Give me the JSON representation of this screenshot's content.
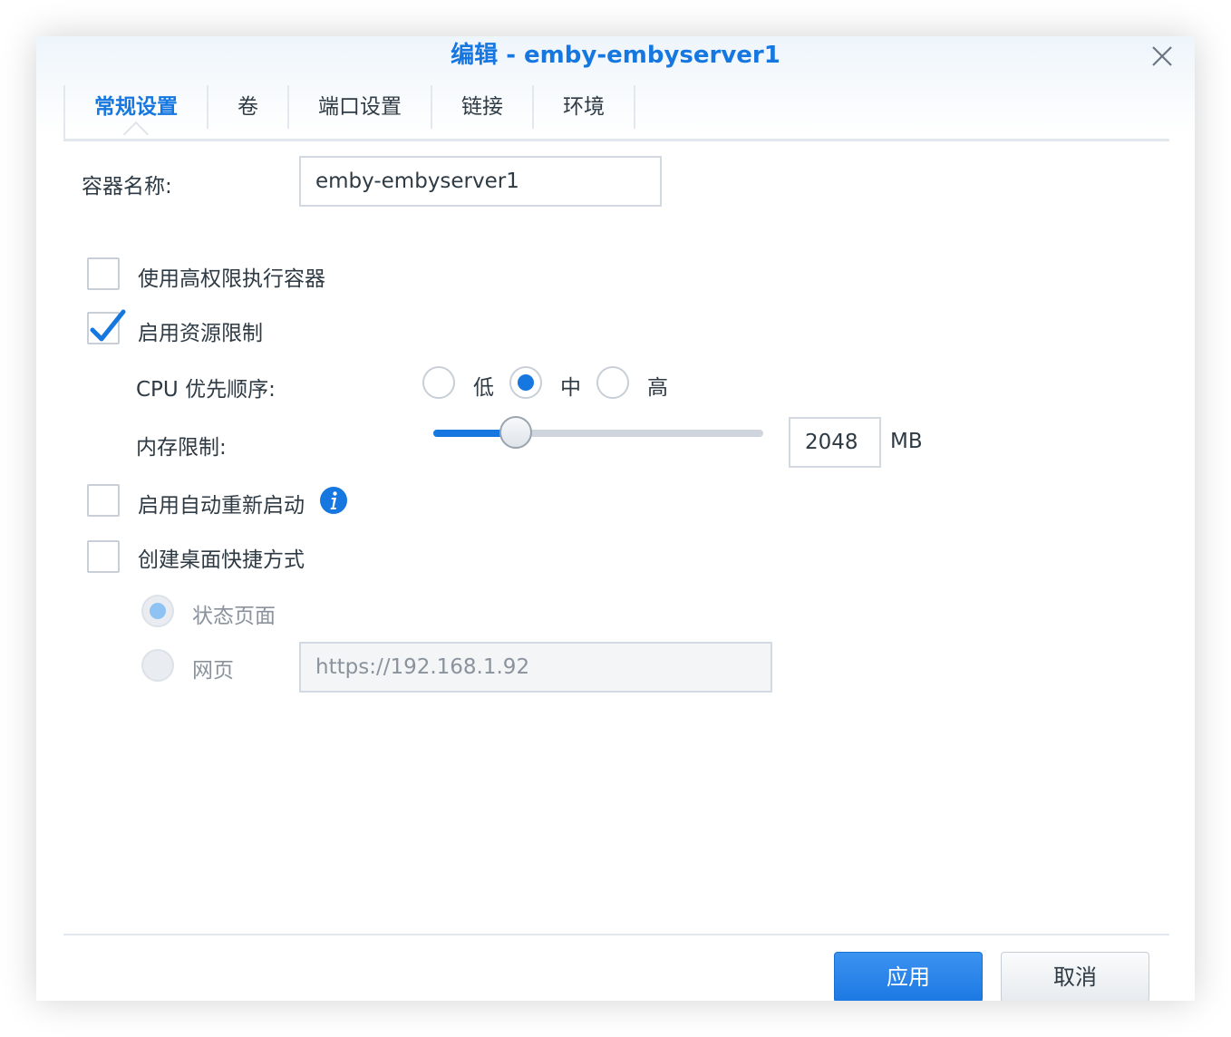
{
  "dialog": {
    "title": "编辑 - emby-embyserver1"
  },
  "tabs": [
    {
      "label": "常规设置",
      "active": true
    },
    {
      "label": "卷",
      "active": false
    },
    {
      "label": "端口设置",
      "active": false
    },
    {
      "label": "链接",
      "active": false
    },
    {
      "label": "环境",
      "active": false
    }
  ],
  "form": {
    "container_name_label": "容器名称:",
    "container_name_value": "emby-embyserver1",
    "privileged": {
      "label": "使用高权限执行容器",
      "checked": false
    },
    "resource_limit": {
      "label": "启用资源限制",
      "checked": true
    },
    "cpu_priority": {
      "label": "CPU 优先顺序:",
      "options": [
        "低",
        "中",
        "高"
      ],
      "selected": "中"
    },
    "memory_limit": {
      "label": "内存限制:",
      "value": "2048",
      "unit": "MB",
      "slider_fraction": 0.25
    },
    "auto_restart": {
      "label": "启用自动重新启动",
      "checked": false
    },
    "desktop_shortcut": {
      "label": "创建桌面快捷方式",
      "checked": false,
      "options": [
        "状态页面",
        "网页"
      ],
      "selected": "状态页面",
      "url_value": "https://192.168.1.92"
    }
  },
  "buttons": {
    "apply": "应用",
    "cancel": "取消"
  },
  "colors": {
    "accent": "#1677e0"
  }
}
